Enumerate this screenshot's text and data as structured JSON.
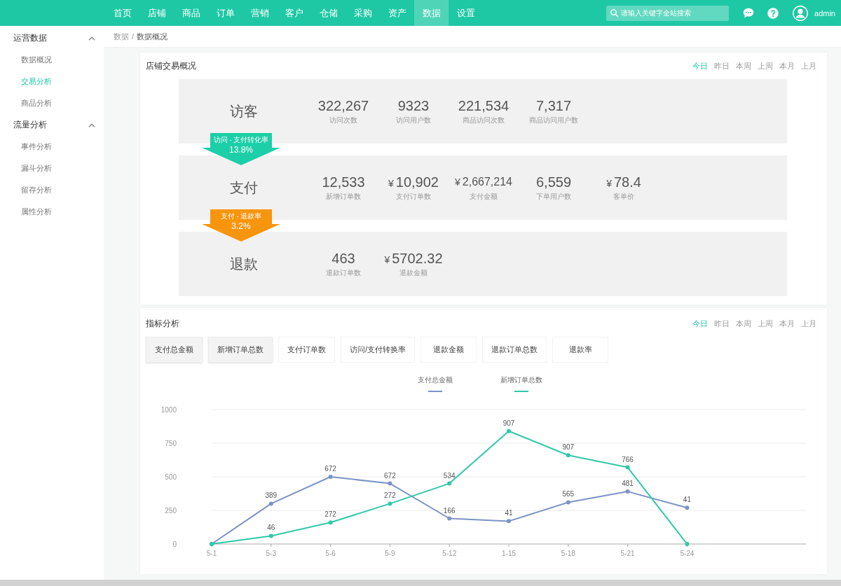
{
  "top_nav": {
    "items": [
      {
        "label": "首页",
        "selected": false
      },
      {
        "label": "店铺",
        "selected": false
      },
      {
        "label": "商品",
        "selected": false
      },
      {
        "label": "订单",
        "selected": false
      },
      {
        "label": "营销",
        "selected": false
      },
      {
        "label": "客户",
        "selected": false
      },
      {
        "label": "仓储",
        "selected": false
      },
      {
        "label": "采购",
        "selected": false
      },
      {
        "label": "资产",
        "selected": false
      },
      {
        "label": "数据",
        "selected": true
      },
      {
        "label": "设置",
        "selected": false
      }
    ],
    "search": {
      "placeholder": "请输入关键字全站搜索"
    },
    "user": {
      "name": "admin"
    }
  },
  "sidebar": {
    "groups": [
      {
        "title": "运营数据",
        "expanded": true,
        "items": [
          {
            "label": "数据概况",
            "selected": false
          },
          {
            "label": "交易分析",
            "selected": true
          },
          {
            "label": "商品分析",
            "selected": false
          }
        ]
      },
      {
        "title": "流量分析",
        "expanded": true,
        "items": [
          {
            "label": "事件分析",
            "selected": false
          },
          {
            "label": "漏斗分析",
            "selected": false
          },
          {
            "label": "留存分析",
            "selected": false
          },
          {
            "label": "属性分析",
            "selected": false
          }
        ]
      }
    ]
  },
  "breadcrumb": {
    "items": [
      "数据",
      "数据概况"
    ],
    "separator": "/"
  },
  "store_overview": {
    "title": "店铺交易概况",
    "periods": [
      {
        "label": "今日",
        "selected": true
      },
      {
        "label": "昨日",
        "selected": false
      },
      {
        "label": "本周",
        "selected": false
      },
      {
        "label": "上周",
        "selected": false
      },
      {
        "label": "本月",
        "selected": false
      },
      {
        "label": "上月",
        "selected": false
      }
    ],
    "stages": [
      {
        "name": "访客",
        "metrics": [
          {
            "value": "322,267",
            "label": "访问次数"
          },
          {
            "value": "9323",
            "label": "访问用户数"
          },
          {
            "value": "221,534",
            "label": "商品访问次数"
          },
          {
            "value": "7,317",
            "label": "商品访问用户数"
          }
        ]
      },
      {
        "name": "支付",
        "metrics": [
          {
            "value": "12,533",
            "label": "新增订单数"
          },
          {
            "currency": "¥",
            "value": "10,902",
            "label": "支付订单数"
          },
          {
            "currency": "¥",
            "value": "2,667,214",
            "label": "支付金额"
          },
          {
            "value": "6,559",
            "label": "下单用户数"
          },
          {
            "currency": "¥",
            "value": "78.4",
            "label": "客单价"
          }
        ]
      },
      {
        "name": "退款",
        "metrics": [
          {
            "value": "463",
            "label": "退款订单数"
          },
          {
            "currency": "¥",
            "value": "5702.32",
            "label": "退款金额"
          }
        ]
      }
    ],
    "conversions": [
      {
        "label": "访问 - 支付转化率",
        "value": "13.8%",
        "color": "#1ccfa8"
      },
      {
        "label": "支付 - 退款率",
        "value": "3.2%",
        "color": "#f7950f"
      }
    ]
  },
  "indicator_analysis": {
    "title": "指标分析",
    "periods": [
      {
        "label": "今日",
        "selected": true
      },
      {
        "label": "昨日",
        "selected": false
      },
      {
        "label": "本周",
        "selected": false
      },
      {
        "label": "上周",
        "selected": false
      },
      {
        "label": "本月",
        "selected": false
      },
      {
        "label": "上月",
        "selected": false
      }
    ],
    "metric_tabs": [
      {
        "label": "支付总金额",
        "selected": true
      },
      {
        "label": "新增订单总数",
        "selected": true
      },
      {
        "label": "支付订单数",
        "selected": false
      },
      {
        "label": "访问/支付转换率",
        "selected": false
      },
      {
        "label": "退款金额",
        "selected": false
      },
      {
        "label": "退款订单总数",
        "selected": false
      },
      {
        "label": "退款率",
        "selected": false
      }
    ],
    "chart_data": {
      "type": "line",
      "categories": [
        "5-1",
        "5-3",
        "5-6",
        "5-9",
        "5-12",
        "1-15",
        "5-18",
        "5-21",
        "5-24"
      ],
      "ylim": [
        0,
        1000
      ],
      "yticks": [
        0,
        250,
        500,
        750,
        1000
      ],
      "grid": true,
      "series": [
        {
          "name": "支付总金额",
          "color": "#7d93c6",
          "marker": "circle",
          "values": [
            0,
            300,
            500,
            450,
            190,
            170,
            310,
            390,
            270
          ]
        },
        {
          "name": "新增订单总数",
          "color": "#2ec9a7",
          "marker": "circle",
          "values": [
            0,
            60,
            160,
            300,
            450,
            840,
            660,
            570,
            0
          ]
        }
      ],
      "annotations": [
        {
          "x": "5-3",
          "y": 300,
          "text": "389"
        },
        {
          "x": "5-6",
          "y": 500,
          "text": "672"
        },
        {
          "x": "5-9",
          "y": 450,
          "text": "672"
        },
        {
          "x": "5-12",
          "y": 190,
          "text": "166"
        },
        {
          "x": "1-15",
          "y": 170,
          "text": "41"
        },
        {
          "x": "5-18",
          "y": 310,
          "text": "565"
        },
        {
          "x": "5-21",
          "y": 390,
          "text": "481"
        },
        {
          "x": "5-24",
          "y": 270,
          "text": "41"
        },
        {
          "x": "5-3",
          "y": 60,
          "text": "46"
        },
        {
          "x": "5-6",
          "y": 160,
          "text": "272"
        },
        {
          "x": "5-9",
          "y": 300,
          "text": "272"
        },
        {
          "x": "5-12",
          "y": 450,
          "text": "534"
        },
        {
          "x": "1-15",
          "y": 840,
          "text": "907"
        },
        {
          "x": "5-18",
          "y": 660,
          "text": "907"
        },
        {
          "x": "5-21",
          "y": 570,
          "text": "766"
        }
      ]
    }
  }
}
